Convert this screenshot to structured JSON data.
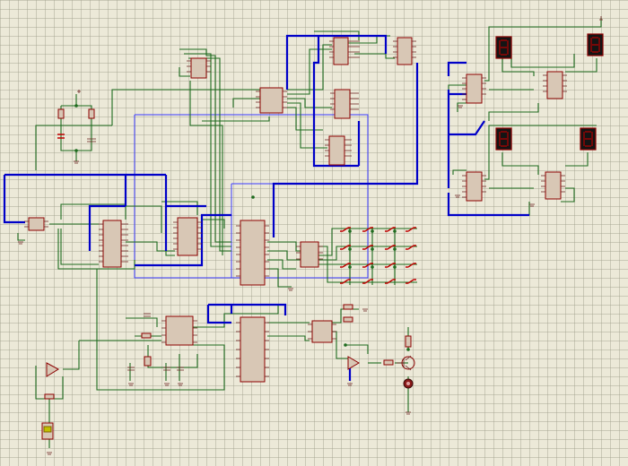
{
  "window": {
    "name": "proteus-schematic-canvas"
  },
  "colors": {
    "grid_background": "#ece9d8",
    "wire_green": "#1e6b1e",
    "bus_blue": "#0000c8",
    "chip_fill": "#d8c7b5",
    "chip_outline": "#8b0000",
    "display_fill": "#141414"
  },
  "display_digit": "8",
  "components": {
    "seven_segment_displays": 4,
    "ic_chips": 18,
    "push_buttons": 16
  }
}
